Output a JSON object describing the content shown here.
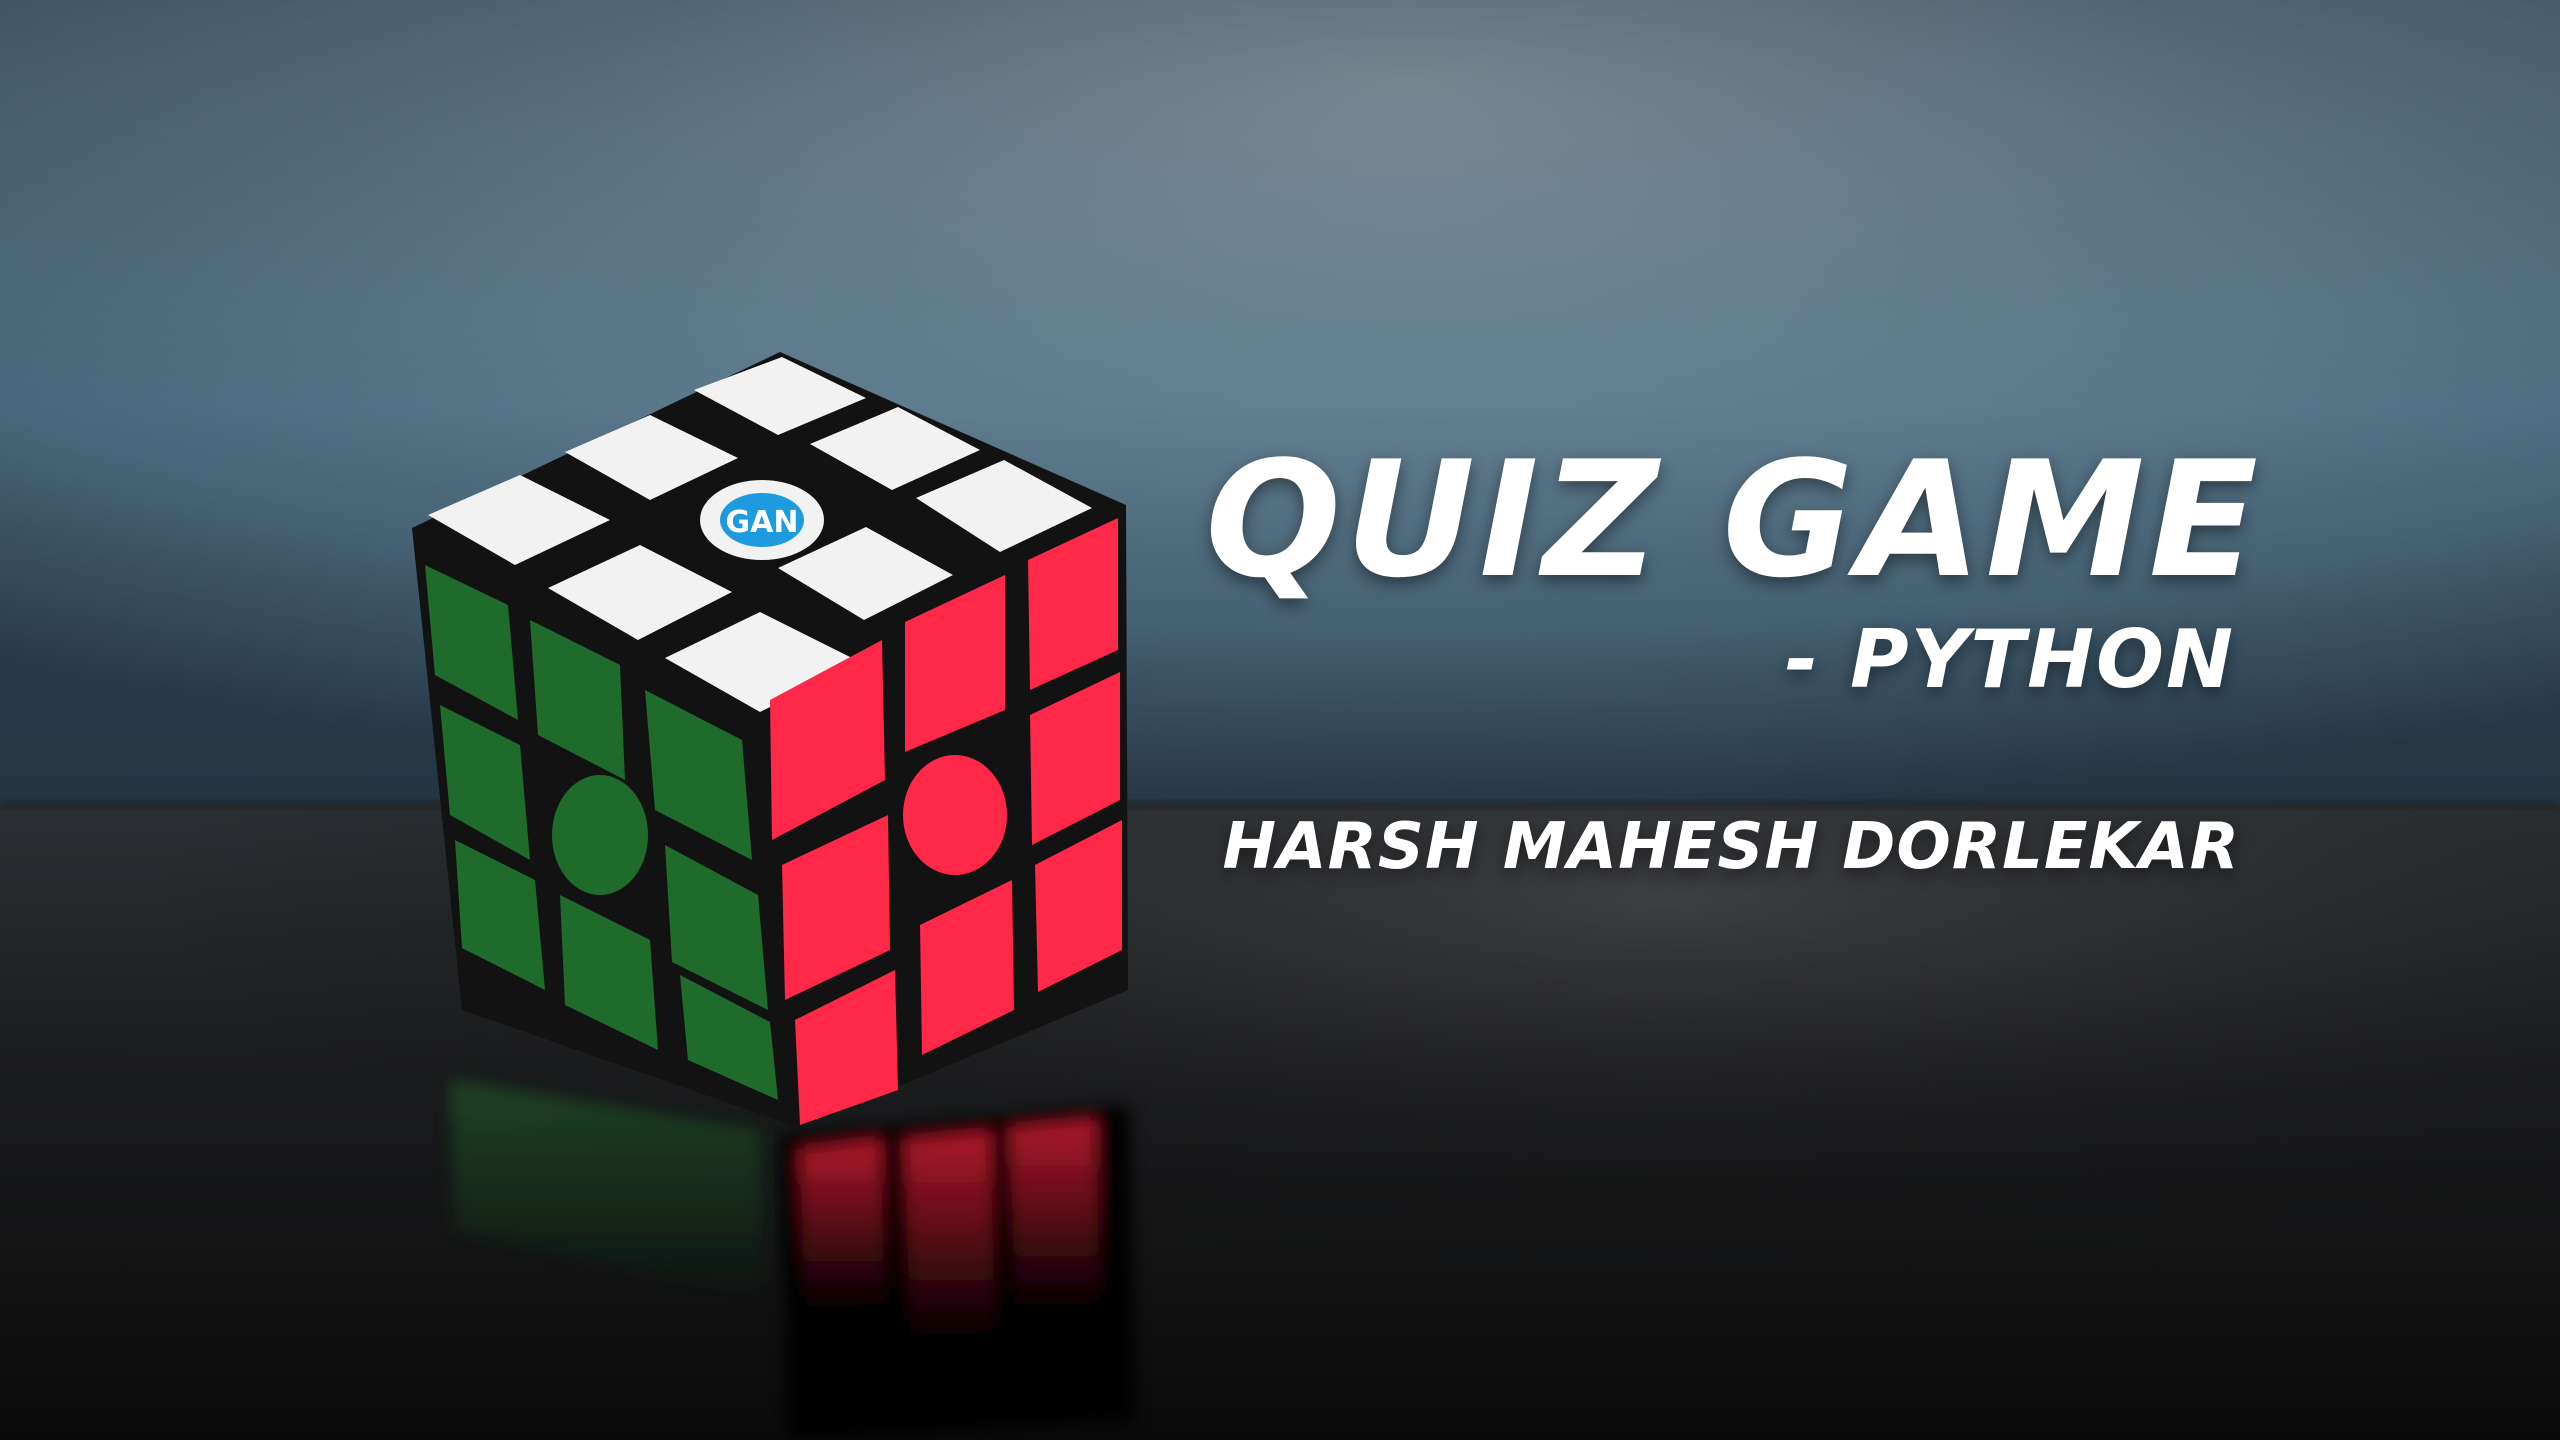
{
  "banner": {
    "title": "QUIZ GAME",
    "subtitle": "-  PYTHON",
    "author": "HARSH MAHESH DORLEKAR"
  },
  "cube": {
    "logo_text": "GAN",
    "face_colors": {
      "top": "#f4f4f4",
      "left": "#1e6b2a",
      "right": "#ff2a4a",
      "body": "#141414"
    }
  },
  "colors": {
    "wall_top": "#5f7f93",
    "wall_mid": "#496a7f",
    "table": "#151515",
    "text": "#ffffff"
  }
}
